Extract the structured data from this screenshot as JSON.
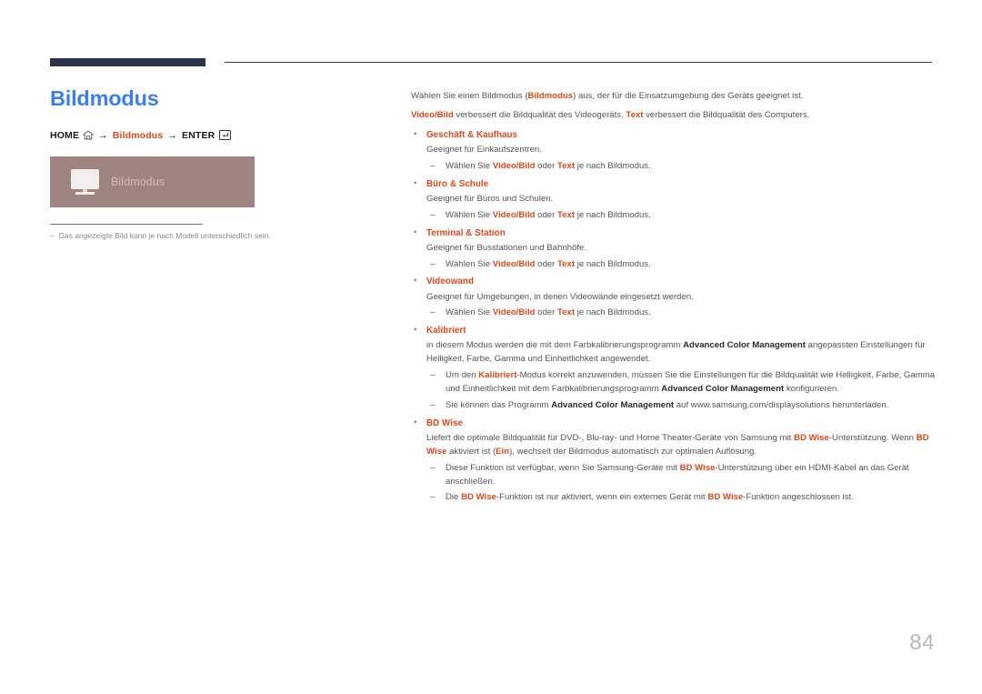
{
  "header": {
    "rule_color": "#2e3050"
  },
  "left": {
    "title": "Bildmodus",
    "breadcrumb": {
      "home_label": "HOME",
      "home_icon": "home-icon",
      "arrow": "→",
      "middle_label": "Bildmodus",
      "enter_label": "ENTER",
      "enter_icon": "enter-key-icon"
    },
    "preview": {
      "icon": "monitor-icon",
      "label": "Bildmodus",
      "background_color": "#9d8481"
    },
    "footnote": {
      "dash": "–",
      "text": "Das angezeigte Bild kann je nach Modell unterschiedlich sein."
    }
  },
  "main": {
    "intro": {
      "line1_a": "Wählen Sie einen Bildmodus (",
      "line1_accent": "Bildmodus",
      "line1_b": ") aus, der für die Einsatzumgebung des Geräts geeignet ist.",
      "line2_accent1": "Video/Bild",
      "line2_a": " verbessert die Bildqualität des Videogeräts. ",
      "line2_accent2": "Text",
      "line2_b": " verbessert die Bildqualität des Computers."
    },
    "bullet_marker": "•",
    "dash_marker": "–",
    "sections": [
      {
        "title": "Geschäft & Kaufhaus",
        "body": "Geeignet für Einkaufszentren.",
        "sub": {
          "a": "Wählen Sie ",
          "acc1": "Video/Bild",
          "b": " oder ",
          "acc2": "Text",
          "c": " je nach Bildmodus."
        }
      },
      {
        "title": "Büro & Schule",
        "body": "Geeignet für Büros und Schulen.",
        "sub": {
          "a": "Wählen Sie ",
          "acc1": "Video/Bild",
          "b": " oder ",
          "acc2": "Text",
          "c": " je nach Bildmodus."
        }
      },
      {
        "title": "Terminal & Station",
        "body": "Geeignet für Busstationen und Bahnhöfe.",
        "sub": {
          "a": "Wählen Sie ",
          "acc1": "Video/Bild",
          "b": " oder ",
          "acc2": "Text",
          "c": " je nach Bildmodus."
        }
      },
      {
        "title": "Videowand",
        "body": "Geeignet für Umgebungen, in denen Videowände eingesetzt werden.",
        "sub": {
          "a": "Wählen Sie ",
          "acc1": "Video/Bild",
          "b": " oder ",
          "acc2": "Text",
          "c": " je nach Bildmodus."
        }
      }
    ],
    "kalibriert": {
      "title": "Kalibriert",
      "body_a": "in diesem Modus werden die mit dem Farbkalibrierungsprogramm ",
      "body_bold": "Advanced Color Management",
      "body_b": " angepassten Einstellungen für Helligkeit, Farbe, Gamma und Einheitlichkeit angewendet.",
      "sub1_a": "Um den ",
      "sub1_acc": "Kalibriert",
      "sub1_b": "-Modus korrekt anzuwenden, müssen Sie die Einstellungen für die Bildqualität wie Helligkeit, Farbe, Gamma und Einheitlichkeit mit dem Farbkalibrierungsprogramm ",
      "sub1_bold": "Advanced Color Management",
      "sub1_c": " konfigurieren.",
      "sub2_a": "Sie können das Programm ",
      "sub2_bold": "Advanced Color Management",
      "sub2_b": " auf www.samsung.com/displaysolutions herunterladen."
    },
    "bdwise": {
      "title": "BD Wise",
      "body_a": "Liefert die optimale Bildqualität für DVD-, Blu-ray- und Home Theater-Geräte von Samsung mit ",
      "body_acc1": "BD Wise",
      "body_b": "-Unterstützung. Wenn ",
      "body_acc2": "BD Wise",
      "body_c": " aktiviert ist (",
      "body_acc3": "Ein",
      "body_d": "), wechselt der Bildmodus automatisch zur optimalen Auflösung.",
      "sub1_a": "Diese Funktion ist verfügbar, wenn Sie Samsung-Geräte mit ",
      "sub1_acc": "BD Wise",
      "sub1_b": "-Unterstützung über ein HDMI-Kabel an das Gerät anschließen.",
      "sub2_a": "Die ",
      "sub2_acc1": "BD Wise",
      "sub2_b": "-Funktion ist nur aktiviert, wenn ein externes Gerät mit ",
      "sub2_acc2": "BD Wise",
      "sub2_c": "-Funktion angeschlossen ist."
    }
  },
  "footer": {
    "page_number": "84"
  },
  "colors": {
    "accent": "#e0471a",
    "title_blue": "#3b7ef0",
    "navy": "#2e3050",
    "preview_bg": "#9d8481"
  }
}
